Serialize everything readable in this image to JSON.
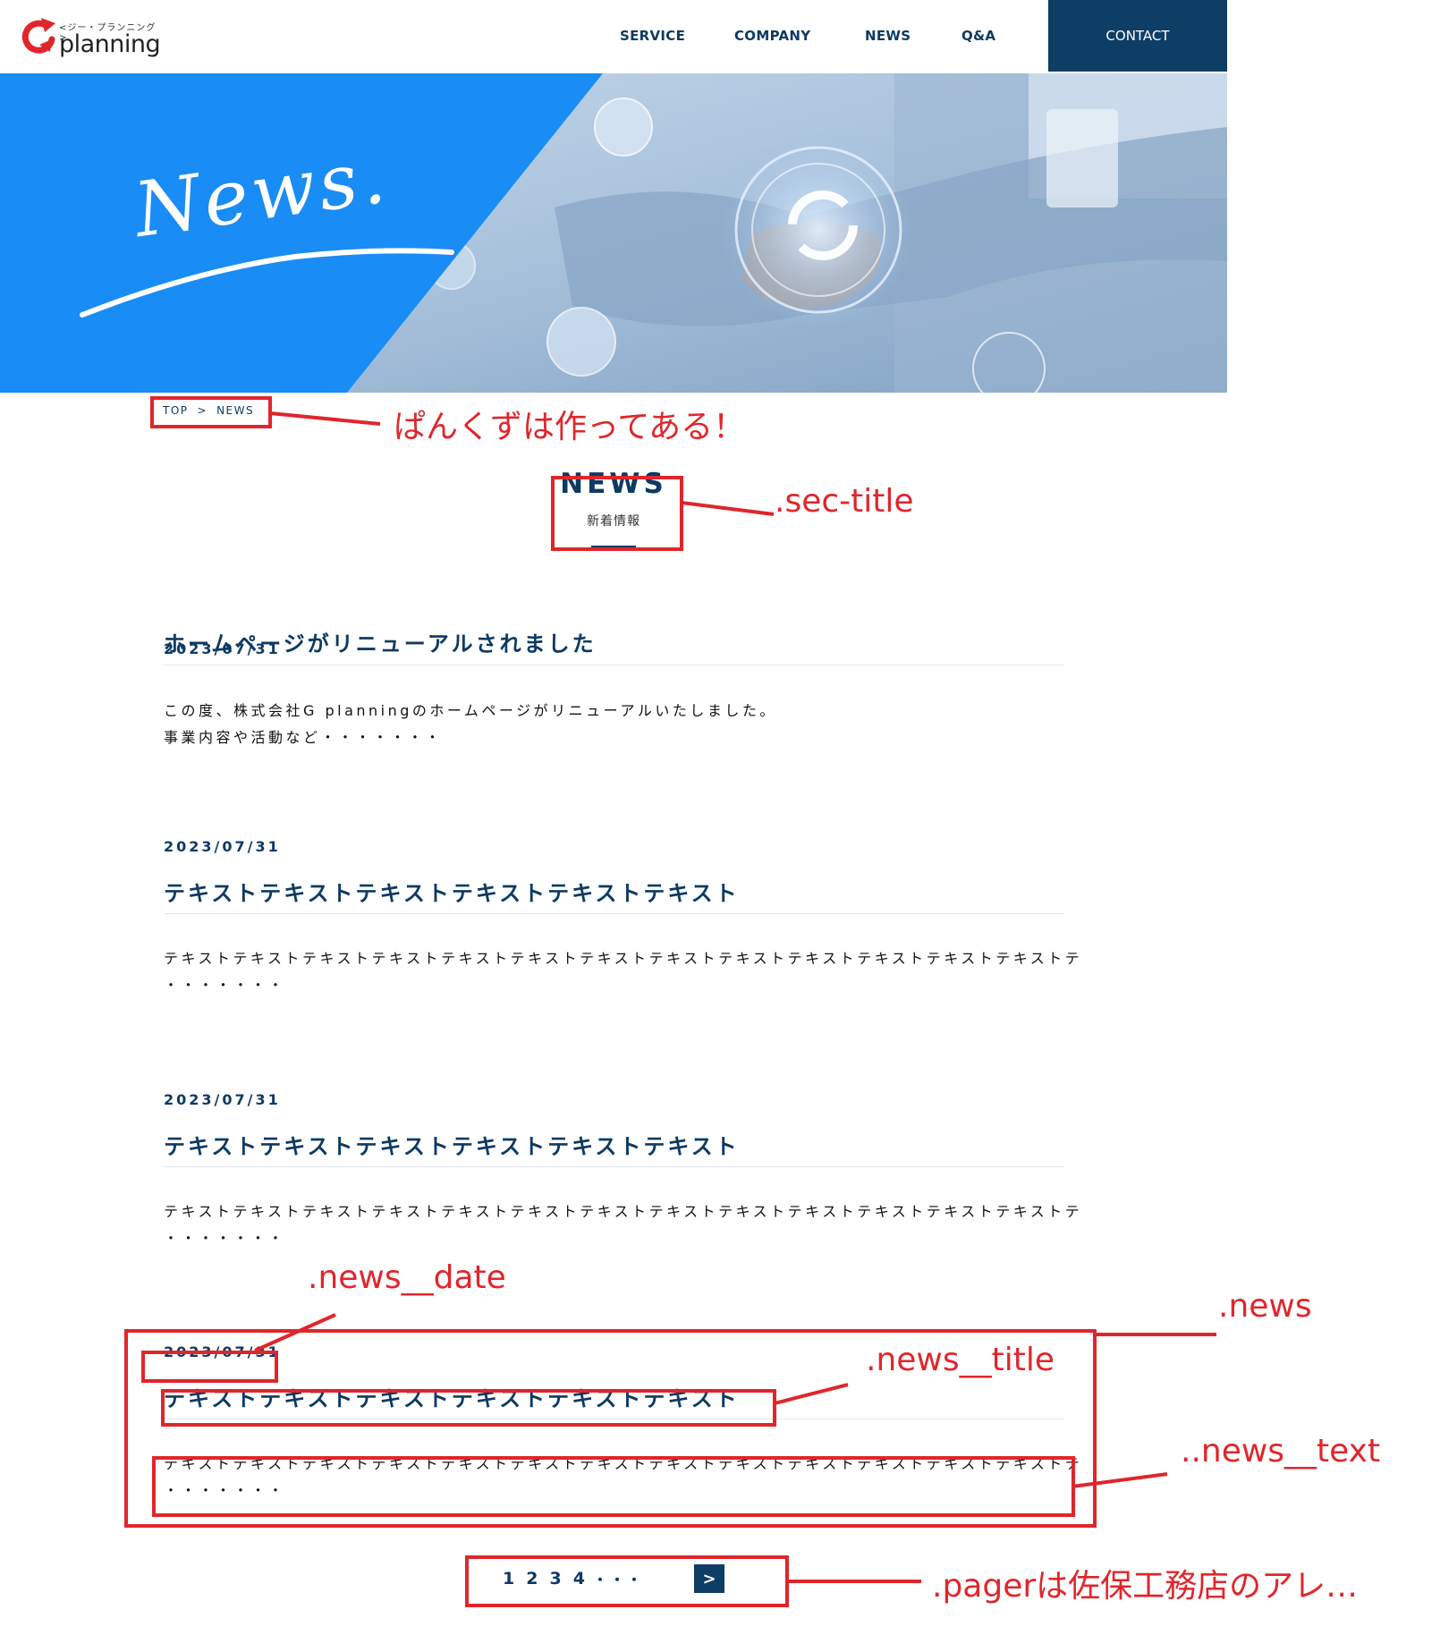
{
  "header": {
    "logo_sub": "<ジー・プランニング>",
    "logo_main": "planning",
    "nav": [
      "SERVICE",
      "COMPANY",
      "NEWS",
      "Q&A"
    ],
    "contact": "CONTACT"
  },
  "hero": {
    "title": "News."
  },
  "breadcrumb": {
    "top": "TOP",
    "sep": ">",
    "current": "NEWS"
  },
  "sec_title": {
    "en": "NEWS",
    "ja": "新着情報"
  },
  "news": [
    {
      "date": "2023/07/31",
      "title": "ホームページがリニューアルされました",
      "text1": "この度、株式会社G planningのホームページがリニューアルいたしました。",
      "text2": "事業内容や活動など・・・・・・・"
    },
    {
      "date": "2023/07/31",
      "title": "テキストテキストテキストテキストテキストテキスト",
      "text1": "テキストテキストテキストテキストテキストテキストテキストテキストテキストテキストテキストテキストテキストテ",
      "text2": "・・・・・・・"
    },
    {
      "date": "2023/07/31",
      "title": "テキストテキストテキストテキストテキストテキスト",
      "text1": "テキストテキストテキストテキストテキストテキストテキストテキストテキストテキストテキストテキストテキストテ",
      "text2": "・・・・・・・"
    },
    {
      "date": "2023/07/31",
      "title": "テキストテキストテキストテキストテキストテキスト",
      "text1": "テキストテキストテキストテキストテキストテキストテキストテキストテキストテキストテキストテキストテキストテ",
      "text2": "・・・・・・・"
    }
  ],
  "pager": {
    "pages": [
      "1",
      "2",
      "3",
      "4"
    ],
    "dots": "・・・",
    "next": ">"
  },
  "annotations": {
    "breadcrumb": "ぱんくずは作ってある！",
    "sec_title": ".sec-title",
    "news_date": ".news__date",
    "news": ".news",
    "news_title": ".news__title",
    "news_text": "..news__text",
    "pager": ".pagerは佐保工務店のアレ…"
  },
  "colors": {
    "navy": "#0e3a63",
    "hero_blue": "#1a8cf5",
    "annotation_red": "#e0262b"
  }
}
